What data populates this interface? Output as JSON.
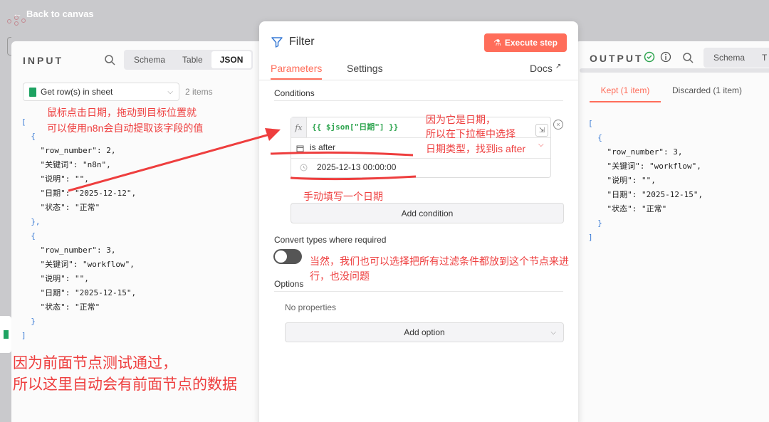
{
  "nav": {
    "back_label": "Back to canvas"
  },
  "input": {
    "title": "INPUT",
    "tabs": [
      "Schema",
      "Table",
      "JSON"
    ],
    "active_tab": "JSON",
    "node_select": "Get row(s) in sheet",
    "items_count": "2 items",
    "json_lines": [
      {
        "t": "[",
        "c": "b"
      },
      {
        "t": "  {",
        "c": "b"
      },
      {
        "t": "    \"row_number\": 2,",
        "c": "k"
      },
      {
        "t": "    \"关键词\": \"n8n\",",
        "c": "k"
      },
      {
        "t": "    \"说明\": \"\",",
        "c": "k"
      },
      {
        "t": "    \"日期\": \"2025-12-12\",",
        "c": "k"
      },
      {
        "t": "    \"状态\": \"正常\"",
        "c": "k"
      },
      {
        "t": "  },",
        "c": "b"
      },
      {
        "t": "  {",
        "c": "b"
      },
      {
        "t": "    \"row_number\": 3,",
        "c": "k"
      },
      {
        "t": "    \"关键词\": \"workflow\",",
        "c": "k"
      },
      {
        "t": "    \"说明\": \"\",",
        "c": "k"
      },
      {
        "t": "    \"日期\": \"2025-12-15\",",
        "c": "k"
      },
      {
        "t": "    \"状态\": \"正常\"",
        "c": "k"
      },
      {
        "t": "  }",
        "c": "b"
      },
      {
        "t": "]",
        "c": "b"
      }
    ]
  },
  "filter": {
    "title": "Filter",
    "execute_label": "Execute step",
    "tabs": [
      "Parameters",
      "Settings"
    ],
    "docs_label": "Docs",
    "conditions_label": "Conditions",
    "expression": "{{ $json[\"日期\"] }}",
    "operator": "is after",
    "value": "2025-12-13 00:00:00",
    "add_condition": "Add condition",
    "convert_label": "Convert types where required",
    "options_label": "Options",
    "no_properties": "No properties",
    "add_option": "Add option"
  },
  "output": {
    "title": "OUTPUT",
    "tabs": [
      "Schema",
      "T"
    ],
    "kept_tab": "Kept (1 item)",
    "discarded_tab": "Discarded (1 item)",
    "json_lines": [
      {
        "t": "[",
        "c": "b"
      },
      {
        "t": "  {",
        "c": "b"
      },
      {
        "t": "    \"row_number\": 3,",
        "c": "k"
      },
      {
        "t": "    \"关键词\": \"workflow\",",
        "c": "k"
      },
      {
        "t": "    \"说明\": \"\",",
        "c": "k"
      },
      {
        "t": "    \"日期\": \"2025-12-15\",",
        "c": "k"
      },
      {
        "t": "    \"状态\": \"正常\"",
        "c": "k"
      },
      {
        "t": "  }",
        "c": "b"
      },
      {
        "t": "]",
        "c": "b"
      }
    ]
  },
  "annotations": {
    "drag_1": "鼠标点击日期，拖动到目标位置就",
    "drag_2": "可以使用n8n会自动提取该字段的值",
    "date_1": "因为它是日期，",
    "date_2": "所以在下拉框中选择",
    "date_3": "日期类型，找到is after",
    "manual": "手动填写一个日期",
    "also_1": "当然，我们也可以选择把所有过滤条件都放到这个节点来进",
    "also_2": "行，也没问题",
    "prev_1": "因为前面节点测试通过，",
    "prev_2": "所以这里自动会有前面节点的数据"
  },
  "colors": {
    "accent": "#ff6d5a",
    "annotation": "#ee3e3e",
    "expression": "#2ea44f"
  }
}
